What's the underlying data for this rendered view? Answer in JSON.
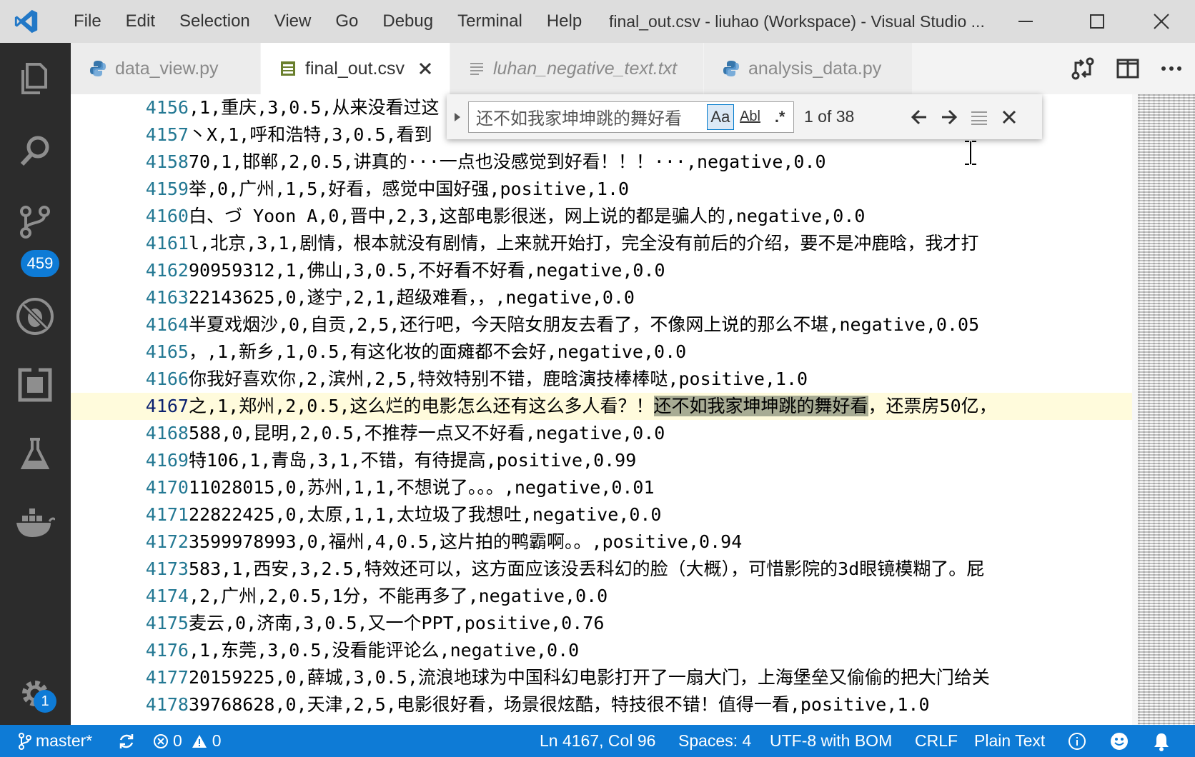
{
  "titlebar": {
    "menu": [
      "File",
      "Edit",
      "Selection",
      "View",
      "Go",
      "Debug",
      "Terminal",
      "Help"
    ],
    "window_title": "final_out.csv - liuhao (Workspace) - Visual Studio ..."
  },
  "activitybar": {
    "scm_badge": "459",
    "settings_badge": "1"
  },
  "tabs": [
    {
      "label": "data_view.py",
      "icon": "python-icon",
      "active": false
    },
    {
      "label": "final_out.csv",
      "icon": "table-icon",
      "active": true
    },
    {
      "label": "luhan_negative_text.txt",
      "icon": "text-file-icon",
      "active": false,
      "preview": true
    },
    {
      "label": "analysis_data.py",
      "icon": "python-icon",
      "active": false
    }
  ],
  "find": {
    "value": "还不如我家坤坤跳的舞好看",
    "match_case": "Aa",
    "whole_word": "Abl",
    "regex": ".*",
    "count": "1 of 38"
  },
  "editor": {
    "current_line": "4167",
    "lines": [
      {
        "n": "4156",
        "text": ",1,重庆,3,0.5,从来没看过这"
      },
      {
        "n": "4157",
        "text": "丶X,1,呼和浩特,3,0.5,看到"
      },
      {
        "n": "4158",
        "text": "70,1,邯郸,2,0.5,讲真的···一点也没感觉到好看！！！···,negative,0.0"
      },
      {
        "n": "4159",
        "text": "举,0,广州,1,5,好看，感觉中国好强,positive,1.0"
      },
      {
        "n": "4160",
        "text": "白、づ Yoon A,0,晋中,2,3,这部电影很迷，网上说的都是骗人的,negative,0.0"
      },
      {
        "n": "4161",
        "text": "l,北京,3,1,剧情，根本就没有剧情，上来就开始打，完全没有前后的介绍，要不是冲鹿晗，我才打"
      },
      {
        "n": "4162",
        "text": "90959312,1,佛山,3,0.5,不好看不好看,negative,0.0"
      },
      {
        "n": "4163",
        "text": "22143625,0,遂宁,2,1,超级难看，，,negative,0.0"
      },
      {
        "n": "4164",
        "text": "半夏戏烟沙,0,自贡,2,5,还行吧，今天陪女朋友去看了，不像网上说的那么不堪,negative,0.05"
      },
      {
        "n": "4165",
        "text": "，,1,新乡,1,0.5,有这化妆的面瘫都不会好,negative,0.0"
      },
      {
        "n": "4166",
        "text": "你我好喜欢你,2,滨州,2,5,特效特别不错，鹿晗演技棒棒哒,positive,1.0"
      },
      {
        "n": "4167",
        "text": "之,1,郑州,2,0.5,这么烂的电影怎么还有这么多人看？！",
        "match": "还不如我家坤坤跳的舞好看",
        "after": "，还票房50亿，"
      },
      {
        "n": "4168",
        "text": "588,0,昆明,2,0.5,不推荐一点又不好看,negative,0.0"
      },
      {
        "n": "4169",
        "text": "特106,1,青岛,3,1,不错，有待提高,positive,0.99"
      },
      {
        "n": "4170",
        "text": "11028015,0,苏州,1,1,不想说了。。。,negative,0.01"
      },
      {
        "n": "4171",
        "text": "22822425,0,太原,1,1,太垃圾了我想吐,negative,0.0"
      },
      {
        "n": "4172",
        "text": "3599978993,0,福州,4,0.5,这片拍的鸭霸啊。。,positive,0.94"
      },
      {
        "n": "4173",
        "text": "583,1,西安,3,2.5,特效还可以，这方面应该没丢科幻的脸（大概），可惜影院的3d眼镜模糊了。屁"
      },
      {
        "n": "4174",
        "text": ",2,广州,2,0.5,1分，不能再多了,negative,0.0"
      },
      {
        "n": "4175",
        "text": "麦云,0,济南,3,0.5,又一个PPT,positive,0.76"
      },
      {
        "n": "4176",
        "text": ",1,东莞,3,0.5,没看能评论么,negative,0.0"
      },
      {
        "n": "4177",
        "text": "20159225,0,薛城,3,0.5,流浪地球为中国科幻电影打开了一扇大门，上海堡垒又偷偷的把大门给关"
      },
      {
        "n": "4178",
        "text": "39768628,0,天津,2,5,电影很好看，场景很炫酷，特技很不错！值得一看,positive,1.0"
      }
    ]
  },
  "statusbar": {
    "branch": "master*",
    "errors": "0",
    "warnings": "0",
    "position": "Ln 4167, Col 96",
    "spaces": "Spaces: 4",
    "encoding": "UTF-8 with BOM",
    "eol": "CRLF",
    "language": "Plain Text"
  },
  "colors": {
    "activitybar": "#2c2c2c",
    "statusbar": "#0e7bd6",
    "line_number": "#237893",
    "current_line_bg": "#fffbdc",
    "find_match_bg": "#a8ac94"
  }
}
